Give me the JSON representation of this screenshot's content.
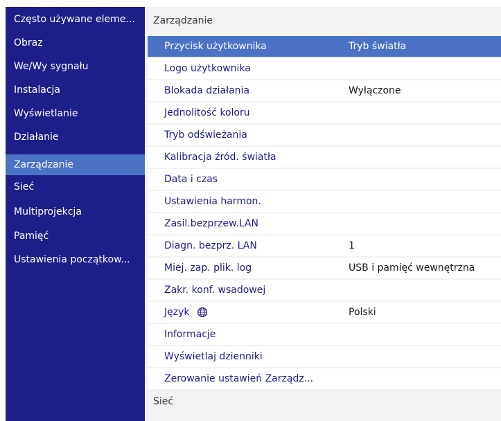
{
  "sidebar": {
    "items": [
      {
        "label": "Często używane eleme..."
      },
      {
        "label": "Obraz"
      },
      {
        "label": "We/Wy sygnału"
      },
      {
        "label": "Instalacja"
      },
      {
        "label": "Wyświetlanie"
      },
      {
        "label": "Działanie"
      },
      {
        "label": "Zarządzanie",
        "selected": true
      },
      {
        "label": "Sieć"
      },
      {
        "label": "Multiprojekcja"
      },
      {
        "label": "Pamięć"
      },
      {
        "label": "Ustawienia początkow..."
      }
    ]
  },
  "main": {
    "section_title": "Zarządzanie",
    "next_section_title": "Sieć",
    "rows": [
      {
        "label": "Przycisk użytkownika",
        "value": "Tryb światła",
        "highlighted": true
      },
      {
        "label": "Logo użytkownika",
        "value": ""
      },
      {
        "label": "Blokada działania",
        "value": "Wyłączone"
      },
      {
        "label": "Jednolitość koloru",
        "value": ""
      },
      {
        "label": "Tryb odświeżania",
        "value": ""
      },
      {
        "label": "Kalibracja źród. światła",
        "value": ""
      },
      {
        "label": "Data i czas",
        "value": ""
      },
      {
        "label": "Ustawienia harmon.",
        "value": ""
      },
      {
        "label": "Zasil.bezprzew.LAN",
        "value": ""
      },
      {
        "label": "Diagn. bezprz. LAN",
        "value": "1"
      },
      {
        "label": "Miej. zap. plik. log",
        "value": "USB i pamięć wewnętrzna"
      },
      {
        "label": "Zakr. konf. wsadowej",
        "value": ""
      },
      {
        "label": "Język",
        "value": "Polski",
        "icon": "globe-icon"
      },
      {
        "label": "Informacje",
        "value": ""
      },
      {
        "label": "Wyświetlaj dzienniki",
        "value": ""
      },
      {
        "label": "Zerowanie ustawień Zarządz...",
        "value": ""
      }
    ]
  },
  "colors": {
    "sidebar_bg": "#1e1e88",
    "selection": "#4a73c6",
    "menu_text": "#1e1e88",
    "panel_bg": "#f2f2f2"
  }
}
